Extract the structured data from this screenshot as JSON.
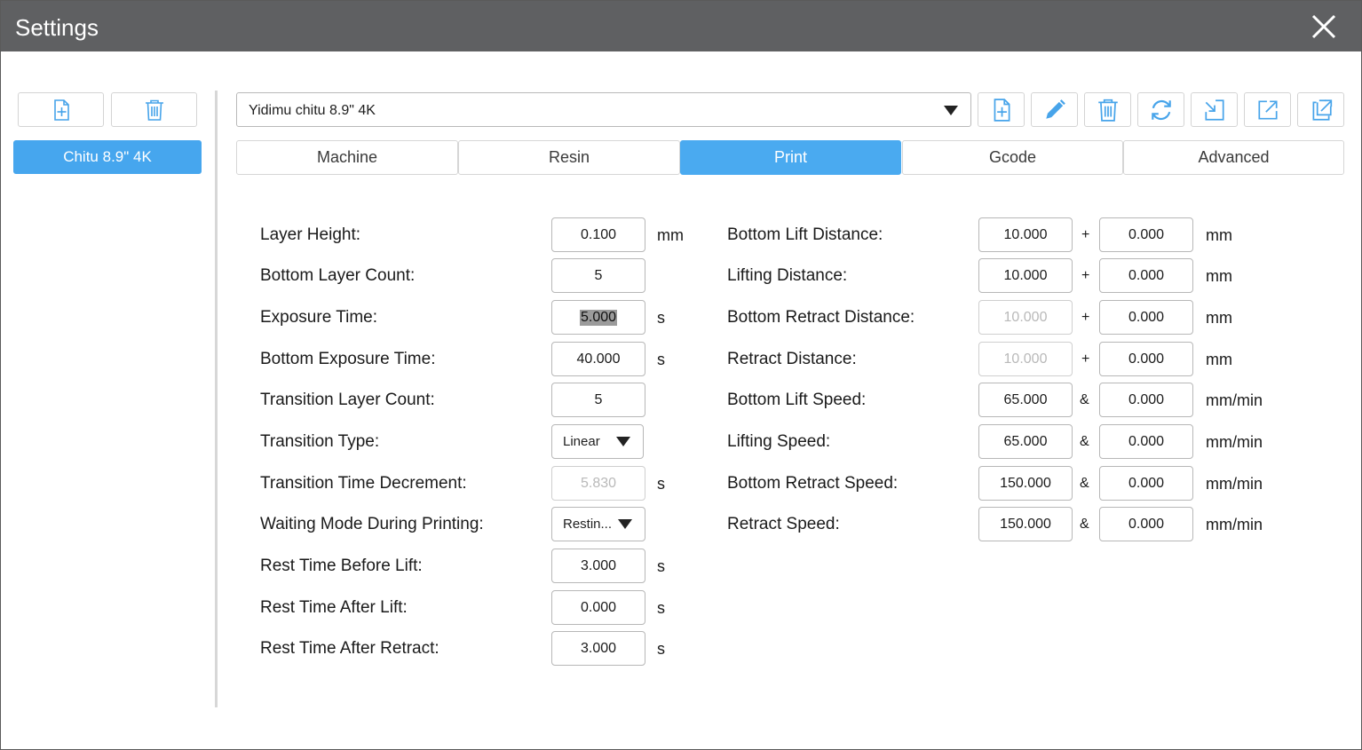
{
  "window": {
    "title": "Settings"
  },
  "left": {
    "profiles": [
      "Chitu 8.9\" 4K"
    ]
  },
  "printer_select": {
    "value": "Yidimu chitu 8.9\" 4K"
  },
  "tabs": [
    "Machine",
    "Resin",
    "Print",
    "Gcode",
    "Advanced"
  ],
  "active_tab": "Print",
  "left_fields": [
    {
      "label": "Layer Height:",
      "value": "0.100",
      "unit": "mm"
    },
    {
      "label": "Bottom Layer Count:",
      "value": "5",
      "unit": ""
    },
    {
      "label": "Exposure Time:",
      "value": "5.000",
      "unit": "s"
    },
    {
      "label": "Bottom Exposure Time:",
      "value": "40.000",
      "unit": "s"
    },
    {
      "label": "Transition Layer Count:",
      "value": "5",
      "unit": ""
    },
    {
      "label": "Transition Type:",
      "value": "Linear",
      "unit": ""
    },
    {
      "label": "Transition Time Decrement:",
      "value": "5.830",
      "unit": "s"
    },
    {
      "label": "Waiting Mode During Printing:",
      "value": "Restin...",
      "unit": ""
    },
    {
      "label": "Rest Time Before Lift:",
      "value": "3.000",
      "unit": "s"
    },
    {
      "label": "Rest Time After Lift:",
      "value": "0.000",
      "unit": "s"
    },
    {
      "label": "Rest Time After Retract:",
      "value": "3.000",
      "unit": "s"
    }
  ],
  "right_fields": [
    {
      "label": "Bottom Lift Distance:",
      "value1": "10.000",
      "sep": "+",
      "value2": "0.000",
      "unit": "mm"
    },
    {
      "label": "Lifting Distance:",
      "value1": "10.000",
      "sep": "+",
      "value2": "0.000",
      "unit": "mm"
    },
    {
      "label": "Bottom Retract Distance:",
      "value1": "10.000",
      "sep": "+",
      "value2": "0.000",
      "unit": "mm"
    },
    {
      "label": "Retract Distance:",
      "value1": "10.000",
      "sep": "+",
      "value2": "0.000",
      "unit": "mm"
    },
    {
      "label": "Bottom Lift Speed:",
      "value1": "65.000",
      "sep": "&",
      "value2": "0.000",
      "unit": "mm/min"
    },
    {
      "label": "Lifting Speed:",
      "value1": "65.000",
      "sep": "&",
      "value2": "0.000",
      "unit": "mm/min"
    },
    {
      "label": "Bottom Retract Speed:",
      "value1": "150.000",
      "sep": "&",
      "value2": "0.000",
      "unit": "mm/min"
    },
    {
      "label": "Retract Speed:",
      "value1": "150.000",
      "sep": "&",
      "value2": "0.000",
      "unit": "mm/min"
    }
  ],
  "colors": {
    "titlebar": "#5f6062",
    "accent": "#4aaaf0",
    "icon": "#47a4ea"
  },
  "icons": [
    "add-file-icon",
    "trash-icon",
    "pencil-icon",
    "refresh-icon",
    "import-icon",
    "export-icon",
    "copy-icon",
    "close-icon"
  ]
}
